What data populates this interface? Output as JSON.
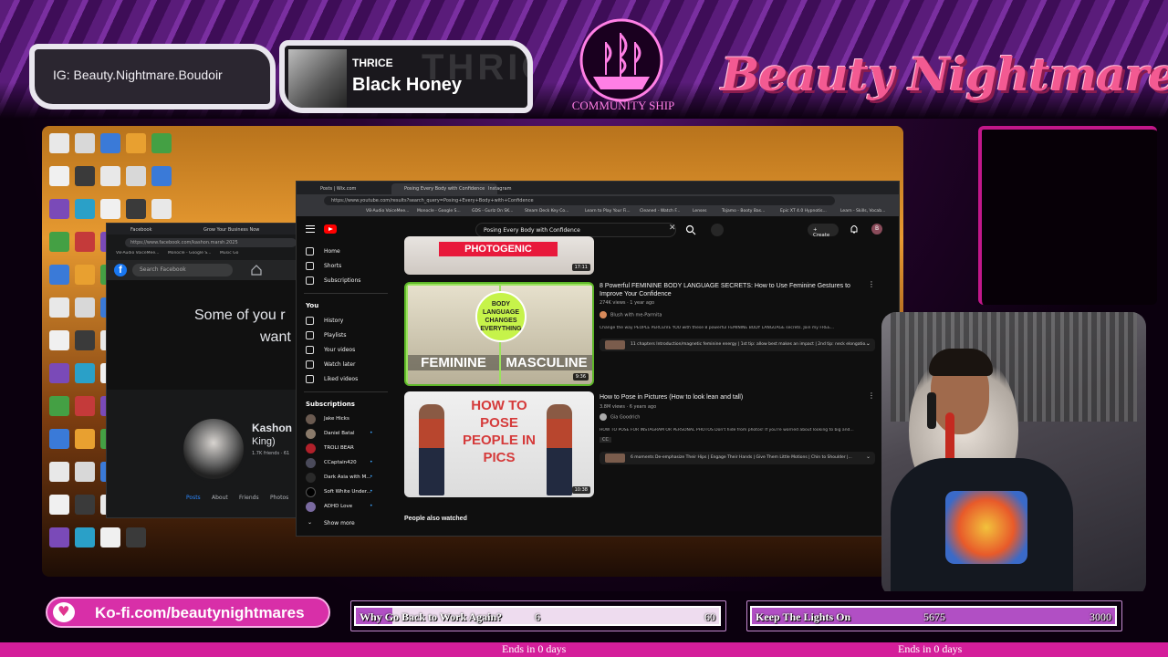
{
  "overlay": {
    "instagram": "IG: Beauty.Nightmare.Boudoir",
    "now_playing": {
      "artist": "THRICE",
      "title": "Black Honey",
      "art_text": "THRICE"
    },
    "community_caption": "COMMUNITY SHIP",
    "brand": "Beauty Nightmares",
    "kofi": "Ko-fi.com/beautynightmares",
    "colors": {
      "accent": "#d41e9a",
      "brand_pink": "#f35a92",
      "goal_fill": "#b14fc4"
    }
  },
  "goals": [
    {
      "label": "Why Go Back to Work Again?",
      "current": "6",
      "target": "60",
      "progress": 0.1,
      "ends": "Ends in 0 days"
    },
    {
      "label": "Keep The Lights On",
      "current": "5675",
      "target": "3000",
      "progress": 1.0,
      "ends": "Ends in 0 days"
    }
  ],
  "facebook": {
    "tabs": [
      "Facebook",
      "Grow Your Business Now"
    ],
    "url": "https://www.facebook.com/kashon.marsh.2025",
    "bookmarks": [
      "V8-Audio VoiceMee...",
      "Monocle - Google S...",
      "Music Go"
    ],
    "search_placeholder": "Search Facebook",
    "quote_line1": "Some of you r",
    "quote_line2": "want",
    "profile_name": "Kashon",
    "profile_name2": "King)",
    "friends": "1.7K friends · 61",
    "nav": [
      "Posts",
      "About",
      "Friends",
      "Photos"
    ]
  },
  "youtube": {
    "tabs": [
      "Posts | Wix.com",
      "Posing Every Body with Confidence",
      "Instagram"
    ],
    "url": "https://www.youtube.com/results?search_query=Posing+Every+Body+with+Confidence",
    "bookmarks": [
      "V8-Audio VoiceMee...",
      "Monocle - Google S...",
      "GDS - Gurlz On SK...",
      "Steam Deck Key Co...",
      "Learn to Play Your Fi...",
      "Cleaned - Watch F...",
      "Lenses",
      "Tojamo - Booty Bas...",
      "Epic XT 4.0 Hypnotis...",
      "Learn - Skills, Vocab..."
    ],
    "search_query": "Posing Every Body with Confidence",
    "create_label": "Create",
    "avatar_letter": "B",
    "sidebar": {
      "main": [
        "Home",
        "Shorts",
        "Subscriptions"
      ],
      "you_header": "You",
      "you": [
        "History",
        "Playlists",
        "Your videos",
        "Watch later",
        "Liked videos"
      ],
      "subs_header": "Subscriptions",
      "subscriptions": [
        "Jake Hicks",
        "Daniel Batal",
        "TROLI BEAR",
        "CCaptain420",
        "Dark Asia with M...",
        "Soft White Under...",
        "ADHD Love"
      ],
      "show_more": "Show more"
    },
    "results": [
      {
        "thumb_text": "PHOTOGENIC",
        "duration": "17:11"
      },
      {
        "thumb_text_left": "FEMININE",
        "thumb_text_right": "MASCULINE",
        "thumb_badge": "BODY LANGUAGE CHANGES EVERYTHING",
        "duration": "9:36",
        "title": "8 Powerful FEMININE BODY LANGUAGE SECRETS: How to Use Feminine Gestures to Improve Your Confidence",
        "meta": "274K views · 1 year ago",
        "channel": "Blush with me-Parmita",
        "desc": "Change the way PEOPLE PERCEIVE YOU with these 8 powerful FEMININE BODY LANGUAGE secrets. Join my FREE...",
        "chapters": "11 chapters   Introduction/magnetic feminine energy | 1st tip: allow best makes an impact | 2nd tip: neck elongatio..."
      },
      {
        "thumb_text": "HOW TO POSE PEOPLE IN PICS",
        "duration": "10:38",
        "title": "How to Pose in Pictures (How to look lean and tall)",
        "meta": "3.8M views · 6 years ago",
        "channel": "Gia Goodrich",
        "desc": "HOW TO POSE FOR INSTAGRAM OR PERSONAL PHOTOS Don't hide from photos! If you're worried about looking to big and...",
        "badge": "CC",
        "chapters": "6 moments   De-emphasize Their Hips | Engage Their Hands | Give Them Little Motions | Chin to Shoulder |..."
      }
    ],
    "people_also_watched": "People also watched"
  }
}
